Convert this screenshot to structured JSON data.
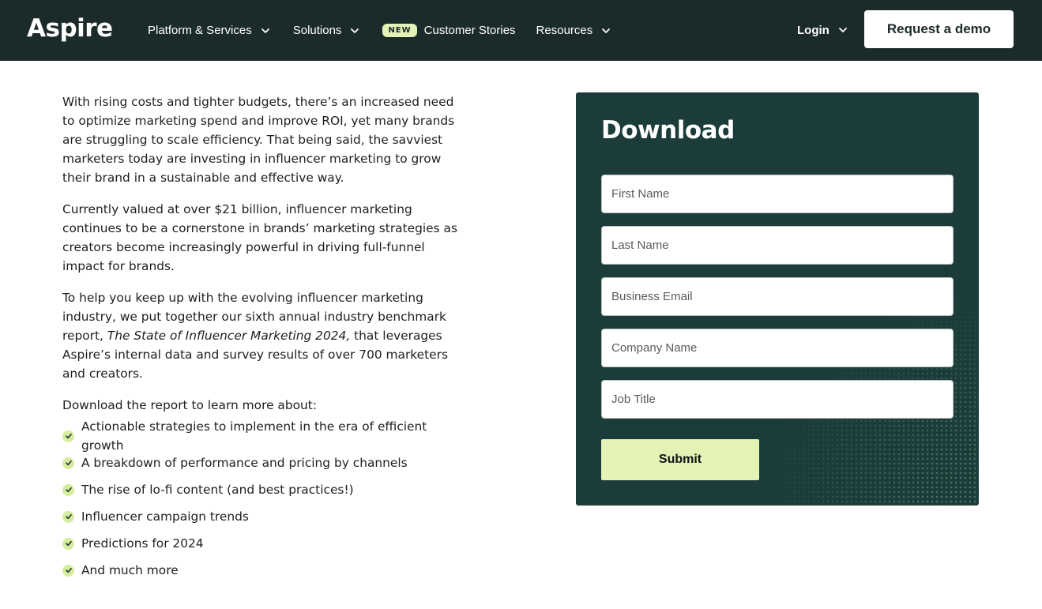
{
  "header": {
    "logo": "Aspire",
    "nav": [
      {
        "label": "Platform & Services",
        "has_dropdown": true,
        "badge": ""
      },
      {
        "label": "Solutions",
        "has_dropdown": true,
        "badge": ""
      },
      {
        "label": "Customer Stories",
        "has_dropdown": false,
        "badge": "NEW"
      },
      {
        "label": "Resources",
        "has_dropdown": true,
        "badge": ""
      }
    ],
    "login_label": "Login",
    "demo_label": "Request a demo"
  },
  "content": {
    "p1": "With rising costs and tighter budgets, there’s an increased need to optimize marketing spend and improve ROI, yet many brands are struggling to scale efficiency. That being said, the savviest marketers today are investing in influencer marketing to grow their brand in a sustainable and effective way.",
    "p2": "Currently valued at over $21 billion, influencer marketing continues to be a cornerstone in brands’ marketing strategies as creators become increasingly powerful in driving full-funnel impact for brands.",
    "p3_before": "To help you keep up with the evolving influencer marketing industry, we put together our sixth annual industry benchmark report, ",
    "p3_italic": "The State of Influencer Marketing 2024,",
    "p3_after": " that leverages Aspire’s internal data and survey results of over 700 marketers and creators.",
    "list_intro": "Download the report to learn more about:",
    "list": [
      "Actionable strategies to implement in the era of efficient growth",
      "A breakdown of performance and pricing by channels",
      "The rise of lo-fi content (and best practices!)",
      "Influencer campaign trends",
      "Predictions for 2024",
      "And much more"
    ]
  },
  "form": {
    "title": "Download",
    "fields": [
      {
        "placeholder": "First Name",
        "value": ""
      },
      {
        "placeholder": "Last Name",
        "value": ""
      },
      {
        "placeholder": "Business Email",
        "value": ""
      },
      {
        "placeholder": "Company Name",
        "value": ""
      },
      {
        "placeholder": "Job Title",
        "value": ""
      }
    ],
    "submit_label": "Submit"
  },
  "colors": {
    "header_bg": "#1a2b2a",
    "panel_bg": "#1b3c38",
    "accent": "#e3f2b5"
  }
}
